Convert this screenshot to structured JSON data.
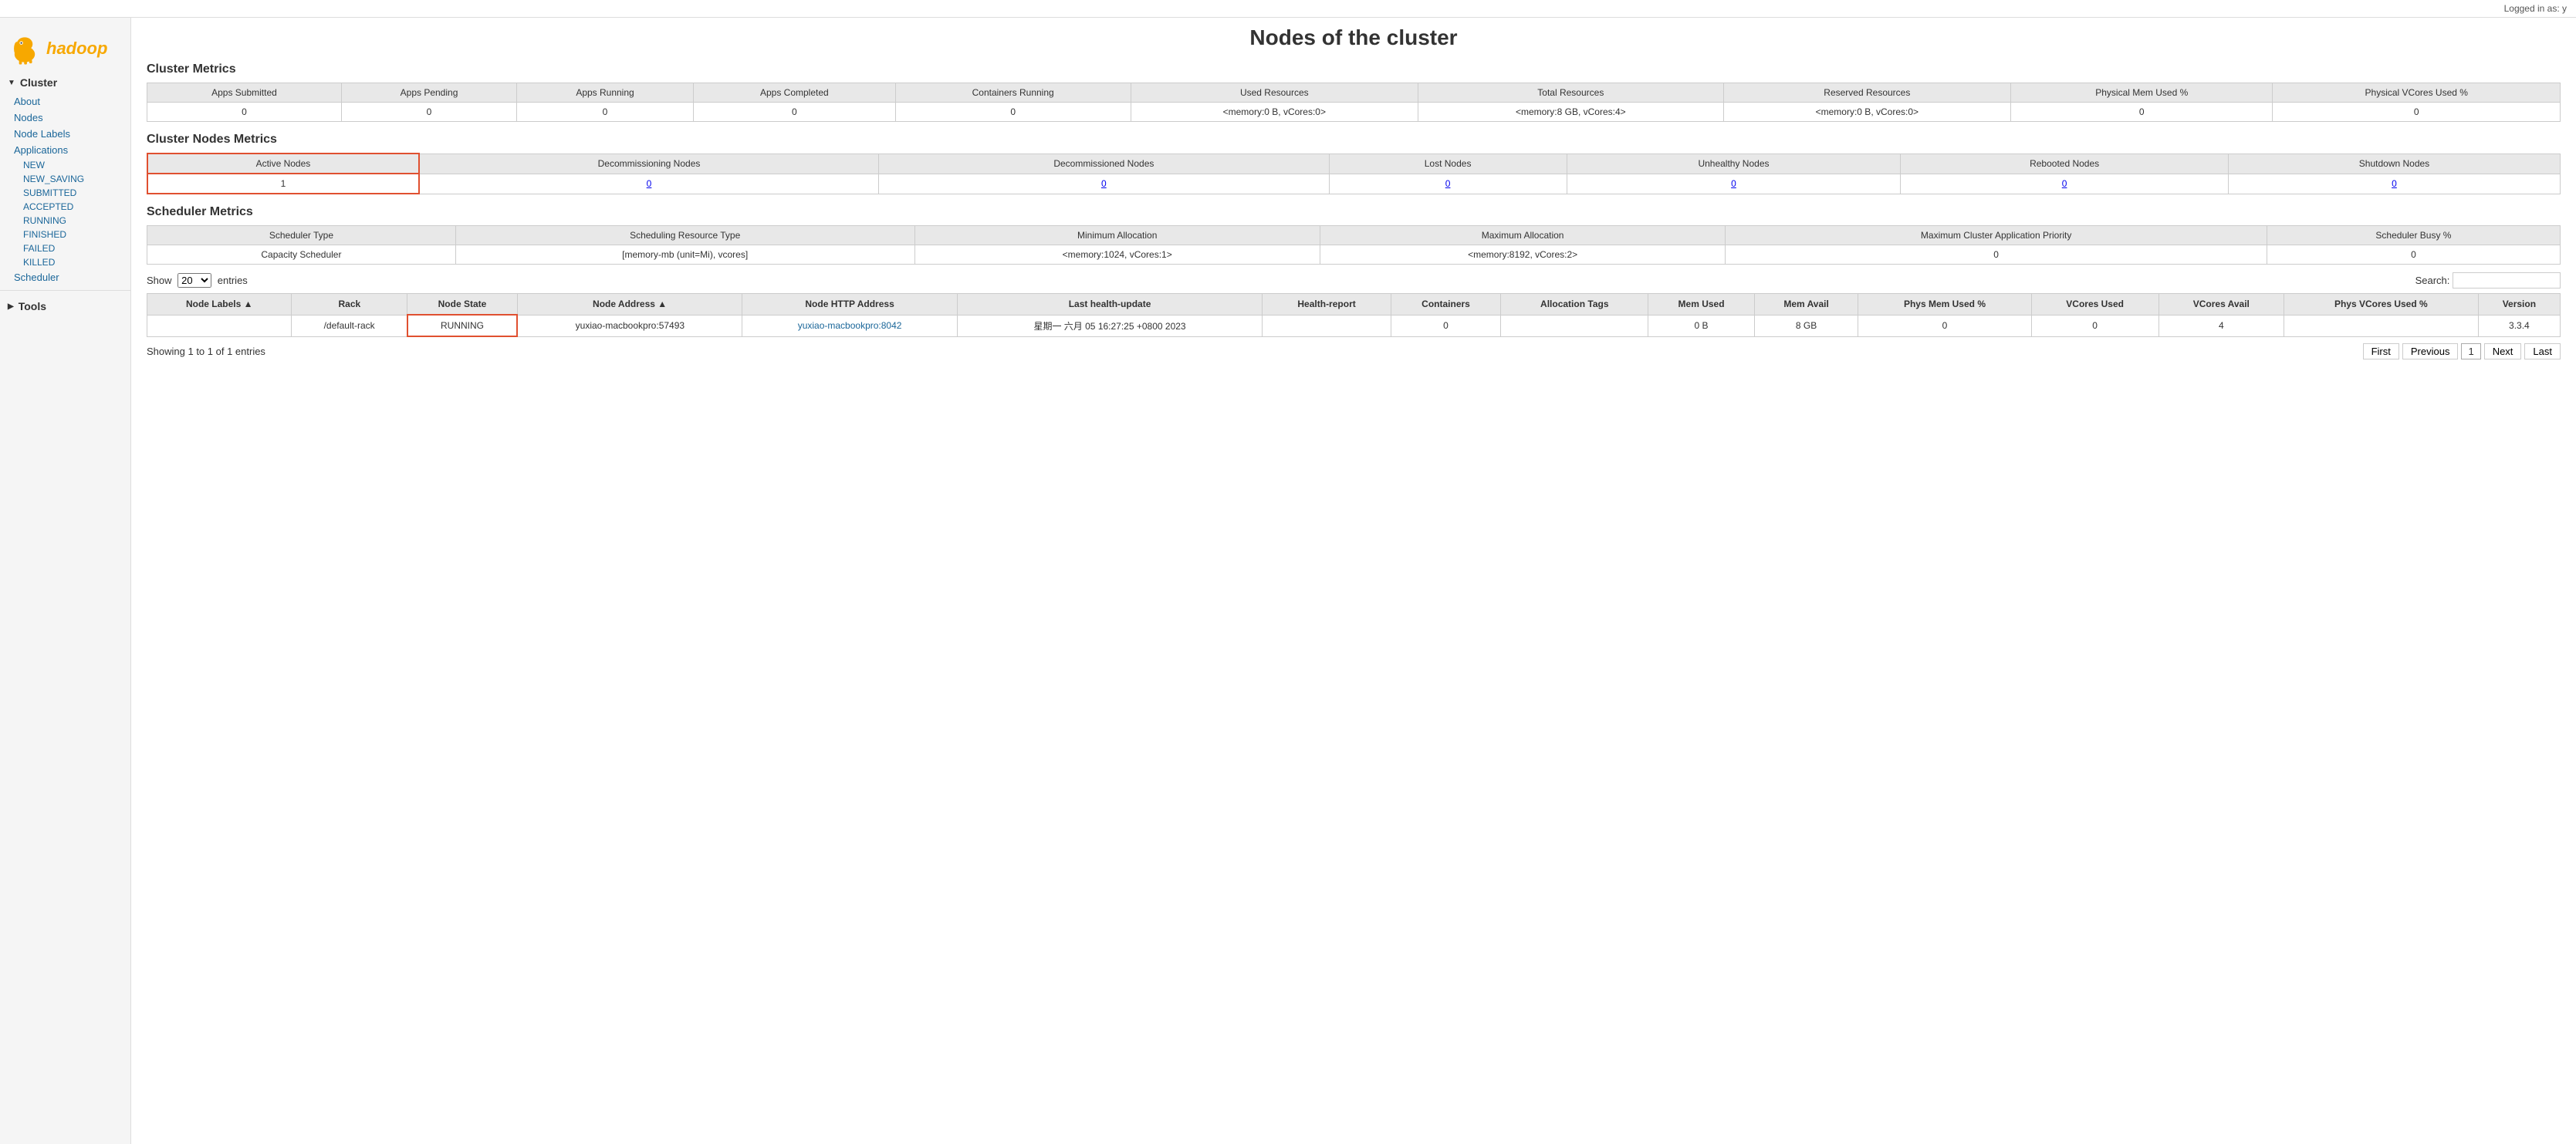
{
  "logged_in": "Logged in as: y",
  "page_title": "Nodes of the cluster",
  "sidebar": {
    "cluster_label": "Cluster",
    "tools_label": "Tools",
    "links": [
      "About",
      "Nodes",
      "Node Labels"
    ],
    "applications_label": "Applications",
    "app_sub_links": [
      "NEW",
      "NEW_SAVING",
      "SUBMITTED",
      "ACCEPTED",
      "RUNNING",
      "FINISHED",
      "FAILED",
      "KILLED"
    ],
    "scheduler_label": "Scheduler"
  },
  "cluster_metrics": {
    "title": "Cluster Metrics",
    "headers": [
      "Apps Submitted",
      "Apps Pending",
      "Apps Running",
      "Apps Completed",
      "Containers Running",
      "Used Resources",
      "Total Resources",
      "Reserved Resources",
      "Physical Mem Used %",
      "Physical VCores Used %"
    ],
    "row": [
      "0",
      "0",
      "0",
      "0",
      "0",
      "<memory:0 B, vCores:0>",
      "<memory:8 GB, vCores:4>",
      "<memory:0 B, vCores:0>",
      "0",
      "0"
    ]
  },
  "cluster_nodes_metrics": {
    "title": "Cluster Nodes Metrics",
    "headers": [
      "Active Nodes",
      "Decommissioning Nodes",
      "Decommissioned Nodes",
      "Lost Nodes",
      "Unhealthy Nodes",
      "Rebooted Nodes",
      "Shutdown Nodes"
    ],
    "row": [
      "1",
      "0",
      "0",
      "0",
      "0",
      "0",
      "0"
    ]
  },
  "scheduler_metrics": {
    "title": "Scheduler Metrics",
    "headers": [
      "Scheduler Type",
      "Scheduling Resource Type",
      "Minimum Allocation",
      "Maximum Allocation",
      "Maximum Cluster Application Priority",
      "Scheduler Busy %"
    ],
    "row": [
      "Capacity Scheduler",
      "[memory-mb (unit=Mi), vcores]",
      "<memory:1024, vCores:1>",
      "<memory:8192, vCores:2>",
      "0",
      "0"
    ]
  },
  "table_controls": {
    "show_label": "Show",
    "entries_label": "entries",
    "search_label": "Search:",
    "entries_value": "20"
  },
  "nodes_table": {
    "headers": [
      "Node Labels",
      "Rack",
      "Node State",
      "Node Address",
      "Node HTTP Address",
      "Last health-update",
      "Health-report",
      "Containers",
      "Allocation Tags",
      "Mem Used",
      "Mem Avail",
      "Phys Mem Used %",
      "VCores Used",
      "VCores Avail",
      "Phys VCores Used %",
      "Version"
    ],
    "rows": [
      {
        "node_labels": "",
        "rack": "/default-rack",
        "node_state": "RUNNING",
        "node_address": "yuxiao-macbookpro:57493",
        "node_http_address": "yuxiao-macbookpro:8042",
        "last_health_update": "星期一 六月 05 16:27:25 +0800 2023",
        "health_report": "",
        "containers": "0",
        "allocation_tags": "",
        "mem_used": "0 B",
        "mem_avail": "8 GB",
        "phys_mem_used": "0",
        "vcores_used": "0",
        "vcores_avail": "4",
        "phys_vcores_used": "",
        "version": "3.3.4"
      }
    ]
  },
  "pagination": {
    "showing_text": "Showing 1 to 1 of 1 entries",
    "first_label": "First",
    "previous_label": "Previous",
    "current_page": "1",
    "next_label": "Next",
    "last_label": "Last"
  }
}
